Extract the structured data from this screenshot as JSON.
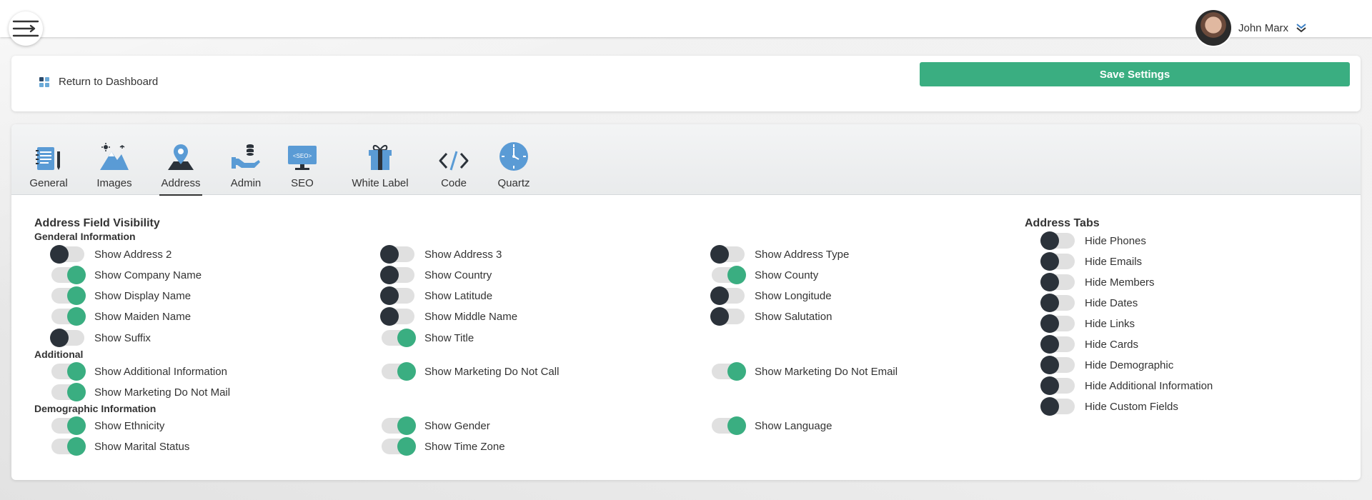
{
  "header": {
    "user_name": "John Marx",
    "return_label": "Return to Dashboard",
    "save_label": "Save Settings"
  },
  "tabs": [
    {
      "label": "General",
      "icon": "notebook-icon"
    },
    {
      "label": "Images",
      "icon": "mountain-image-icon"
    },
    {
      "label": "Address",
      "icon": "map-pin-icon",
      "active": true
    },
    {
      "label": "Admin",
      "icon": "hand-coins-icon"
    },
    {
      "label": "SEO",
      "icon": "seo-monitor-icon"
    },
    {
      "label": "White Label",
      "icon": "gift-box-icon"
    },
    {
      "label": "Code",
      "icon": "code-icon"
    },
    {
      "label": "Quartz",
      "icon": "clock-icon"
    }
  ],
  "visibility": {
    "heading": "Address Field Visibility",
    "general": {
      "title": "Genderal Information",
      "items": [
        {
          "label": "Show Address 2",
          "on": false
        },
        {
          "label": "Show Address 3",
          "on": false
        },
        {
          "label": "Show Address Type",
          "on": false
        },
        {
          "label": "Show Company Name",
          "on": true
        },
        {
          "label": "Show Country",
          "on": false
        },
        {
          "label": "Show County",
          "on": true
        },
        {
          "label": "Show Display Name",
          "on": true
        },
        {
          "label": "Show Latitude",
          "on": false
        },
        {
          "label": "Show Longitude",
          "on": false
        },
        {
          "label": "Show Maiden Name",
          "on": true
        },
        {
          "label": "Show Middle Name",
          "on": false
        },
        {
          "label": "Show Salutation",
          "on": false
        },
        {
          "label": "Show Suffix",
          "on": false
        },
        {
          "label": "Show Title",
          "on": true
        }
      ]
    },
    "additional": {
      "title": "Additional",
      "items": [
        {
          "label": "Show Additional Information",
          "on": true
        },
        {
          "label": "Show Marketing Do Not Call",
          "on": true
        },
        {
          "label": "Show Marketing Do Not Email",
          "on": true
        },
        {
          "label": "Show Marketing Do Not Mail",
          "on": true
        }
      ]
    },
    "demographic": {
      "title": "Demographic Information",
      "items": [
        {
          "label": "Show Ethnicity",
          "on": true
        },
        {
          "label": "Show Gender",
          "on": true
        },
        {
          "label": "Show Language",
          "on": true
        },
        {
          "label": "Show Marital Status",
          "on": true
        },
        {
          "label": "Show Time Zone",
          "on": true
        }
      ]
    }
  },
  "address_tabs": {
    "heading": "Address Tabs",
    "items": [
      {
        "label": "Hide Phones",
        "on": false
      },
      {
        "label": "Hide Emails",
        "on": false
      },
      {
        "label": "Hide Members",
        "on": false
      },
      {
        "label": "Hide Dates",
        "on": false
      },
      {
        "label": "Hide Links",
        "on": false
      },
      {
        "label": "Hide Cards",
        "on": false
      },
      {
        "label": "Hide Demographic",
        "on": false
      },
      {
        "label": "Hide Additional Information",
        "on": false
      },
      {
        "label": "Hide Custom Fields",
        "on": false
      }
    ]
  },
  "colors": {
    "accent": "#3aae81",
    "toggle_off_knob": "#2b323a",
    "toggle_track": "#e0e0e0"
  }
}
